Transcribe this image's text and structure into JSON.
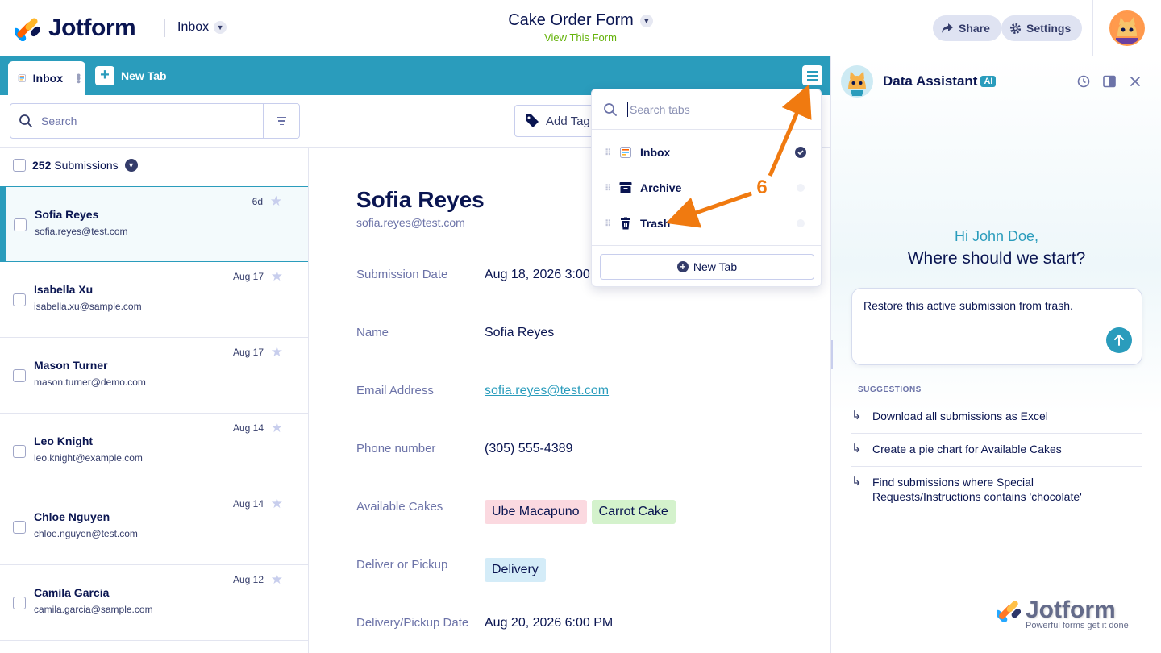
{
  "header": {
    "brand": "Jotform",
    "inbox_label": "Inbox",
    "form_title": "Cake Order Form",
    "view_form_link": "View This Form",
    "share_label": "Share",
    "settings_label": "Settings"
  },
  "tabbar": {
    "active_tab": "Inbox",
    "new_tab_label": "New Tab"
  },
  "toolbar": {
    "search_placeholder": "Search",
    "add_tag_label": "Add Tag"
  },
  "list": {
    "count": "252",
    "count_label": "Submissions",
    "rows": [
      {
        "name": "Sofia Reyes",
        "email": "sofia.reyes@test.com",
        "date": "6d",
        "selected": true
      },
      {
        "name": "Isabella Xu",
        "email": "isabella.xu@sample.com",
        "date": "Aug 17"
      },
      {
        "name": "Mason Turner",
        "email": "mason.turner@demo.com",
        "date": "Aug 17"
      },
      {
        "name": "Leo Knight",
        "email": "leo.knight@example.com",
        "date": "Aug 14"
      },
      {
        "name": "Chloe Nguyen",
        "email": "chloe.nguyen@test.com",
        "date": "Aug 14"
      },
      {
        "name": "Camila Garcia",
        "email": "camila.garcia@sample.com",
        "date": "Aug 12"
      }
    ]
  },
  "detail": {
    "name": "Sofia Reyes",
    "email": "sofia.reyes@test.com",
    "fields": [
      {
        "label": "Submission Date",
        "value": "Aug 18, 2026 3:00"
      },
      {
        "label": "Name",
        "value": "Sofia Reyes"
      },
      {
        "label": "Email Address",
        "value": "sofia.reyes@test.com"
      },
      {
        "label": "Phone number",
        "value": "(305) 555-4389"
      },
      {
        "label": "Available Cakes",
        "chips": [
          "Ube Macapuno",
          "Carrot Cake"
        ]
      },
      {
        "label": "Deliver or Pickup",
        "chips": [
          "Delivery"
        ]
      },
      {
        "label": "Delivery/Pickup Date",
        "value": "Aug 20, 2026 6:00 PM"
      }
    ]
  },
  "tabs_dropdown": {
    "search_placeholder": "Search tabs",
    "items": [
      {
        "label": "Inbox",
        "icon": "inbox-icon",
        "active": true
      },
      {
        "label": "Archive",
        "icon": "archive-icon",
        "active": false
      },
      {
        "label": "Trash",
        "icon": "trash-icon",
        "active": false
      }
    ],
    "new_tab_label": "New Tab"
  },
  "annotation": {
    "step_number": "6",
    "color": "#f07a10"
  },
  "assistant": {
    "title": "Data Assistant",
    "ai_badge": "AI",
    "greeting": "Hi John Doe,",
    "prompt_question": "Where should we start?",
    "input_text": "Restore this active submission from trash.",
    "suggestions_heading": "SUGGESTIONS",
    "suggestions": [
      "Download all submissions as Excel",
      "Create a pie chart for Available Cakes",
      "Find submissions where Special Requests/Instructions contains 'chocolate'"
    ],
    "watermark_brand": "Jotform",
    "watermark_tagline": "Powerful forms get it done"
  },
  "colors": {
    "accent": "#2a9cbc",
    "navy": "#0a1551",
    "view_link": "#64b20a",
    "chip_pink": "#fbd9e0",
    "chip_green": "#d4f2cc",
    "chip_blue": "#d4ecf8"
  }
}
